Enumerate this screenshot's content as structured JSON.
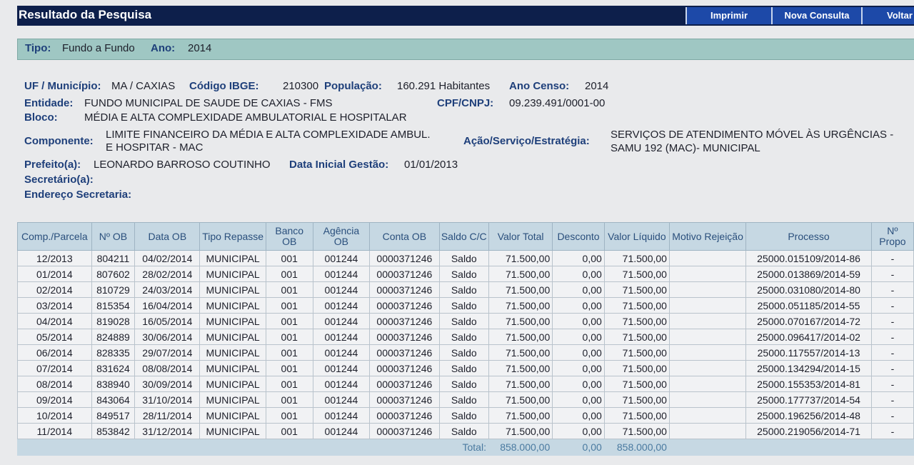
{
  "header": {
    "title": "Resultado da Pesquisa",
    "buttons": [
      "Imprimir",
      "Nova Consulta",
      "Voltar"
    ]
  },
  "tipo": {
    "tipo_label": "Tipo:",
    "tipo_value": "Fundo a Fundo",
    "ano_label": "Ano:",
    "ano_value": "2014"
  },
  "info": {
    "uf_label": "UF / Município:",
    "uf_value": "MA / CAXIAS",
    "ibge_label": "Código IBGE:",
    "ibge_value": "210300",
    "pop_label": "População:",
    "pop_value": "160.291 Habitantes",
    "censo_label": "Ano Censo:",
    "censo_value": "2014",
    "entidade_label": "Entidade:",
    "entidade_value": "FUNDO MUNICIPAL DE SAUDE DE CAXIAS - FMS",
    "cnpj_label": "CPF/CNPJ:",
    "cnpj_value": "09.239.491/0001-00",
    "bloco_label": "Bloco:",
    "bloco_value": "MÉDIA E ALTA COMPLEXIDADE AMBULATORIAL E HOSPITALAR",
    "componente_label": "Componente:",
    "componente_value_1": "LIMITE FINANCEIRO DA MÉDIA E ALTA COMPLEXIDADE AMBUL.",
    "componente_value_2": "E HOSPITAR - MAC",
    "acao_label": "Ação/Serviço/Estratégia:",
    "acao_value_1": "SERVIÇOS DE ATENDIMENTO MÓVEL ÀS URGÊNCIAS -",
    "acao_value_2": "SAMU 192 (MAC)- MUNICIPAL",
    "prefeito_label": "Prefeito(a):",
    "prefeito_value": "LEONARDO BARROSO COUTINHO",
    "gestao_label": "Data Inicial Gestão:",
    "gestao_value": "01/01/2013",
    "secretario_label": "Secretário(a):",
    "endereco_label": "Endereço Secretaria:"
  },
  "table": {
    "headers": [
      "Comp./Parcela",
      "Nº OB",
      "Data OB",
      "Tipo Repasse",
      "Banco OB",
      "Agência OB",
      "Conta OB",
      "Saldo C/C",
      "Valor Total",
      "Desconto",
      "Valor Líquido",
      "Motivo Rejeição",
      "Processo",
      "Nº Propo"
    ],
    "rows": [
      [
        "12/2013",
        "804211",
        "04/02/2014",
        "MUNICIPAL",
        "001",
        "001244",
        "0000371246",
        "Saldo",
        "71.500,00",
        "0,00",
        "71.500,00",
        "",
        "25000.015109/2014-86",
        "-"
      ],
      [
        "01/2014",
        "807602",
        "28/02/2014",
        "MUNICIPAL",
        "001",
        "001244",
        "0000371246",
        "Saldo",
        "71.500,00",
        "0,00",
        "71.500,00",
        "",
        "25000.013869/2014-59",
        "-"
      ],
      [
        "02/2014",
        "810729",
        "24/03/2014",
        "MUNICIPAL",
        "001",
        "001244",
        "0000371246",
        "Saldo",
        "71.500,00",
        "0,00",
        "71.500,00",
        "",
        "25000.031080/2014-80",
        "-"
      ],
      [
        "03/2014",
        "815354",
        "16/04/2014",
        "MUNICIPAL",
        "001",
        "001244",
        "0000371246",
        "Saldo",
        "71.500,00",
        "0,00",
        "71.500,00",
        "",
        "25000.051185/2014-55",
        "-"
      ],
      [
        "04/2014",
        "819028",
        "16/05/2014",
        "MUNICIPAL",
        "001",
        "001244",
        "0000371246",
        "Saldo",
        "71.500,00",
        "0,00",
        "71.500,00",
        "",
        "25000.070167/2014-72",
        "-"
      ],
      [
        "05/2014",
        "824889",
        "30/06/2014",
        "MUNICIPAL",
        "001",
        "001244",
        "0000371246",
        "Saldo",
        "71.500,00",
        "0,00",
        "71.500,00",
        "",
        "25000.096417/2014-02",
        "-"
      ],
      [
        "06/2014",
        "828335",
        "29/07/2014",
        "MUNICIPAL",
        "001",
        "001244",
        "0000371246",
        "Saldo",
        "71.500,00",
        "0,00",
        "71.500,00",
        "",
        "25000.117557/2014-13",
        "-"
      ],
      [
        "07/2014",
        "831624",
        "08/08/2014",
        "MUNICIPAL",
        "001",
        "001244",
        "0000371246",
        "Saldo",
        "71.500,00",
        "0,00",
        "71.500,00",
        "",
        "25000.134294/2014-15",
        "-"
      ],
      [
        "08/2014",
        "838940",
        "30/09/2014",
        "MUNICIPAL",
        "001",
        "001244",
        "0000371246",
        "Saldo",
        "71.500,00",
        "0,00",
        "71.500,00",
        "",
        "25000.155353/2014-81",
        "-"
      ],
      [
        "09/2014",
        "843064",
        "31/10/2014",
        "MUNICIPAL",
        "001",
        "001244",
        "0000371246",
        "Saldo",
        "71.500,00",
        "0,00",
        "71.500,00",
        "",
        "25000.177737/2014-54",
        "-"
      ],
      [
        "10/2014",
        "849517",
        "28/11/2014",
        "MUNICIPAL",
        "001",
        "001244",
        "0000371246",
        "Saldo",
        "71.500,00",
        "0,00",
        "71.500,00",
        "",
        "25000.196256/2014-48",
        "-"
      ],
      [
        "11/2014",
        "853842",
        "31/12/2014",
        "MUNICIPAL",
        "001",
        "001244",
        "0000371246",
        "Saldo",
        "71.500,00",
        "0,00",
        "71.500,00",
        "",
        "25000.219056/2014-71",
        "-"
      ]
    ],
    "total": {
      "label": "Total:",
      "valor_total": "858.000,00",
      "desconto": "0,00",
      "valor_liquido": "858.000,00"
    }
  }
}
